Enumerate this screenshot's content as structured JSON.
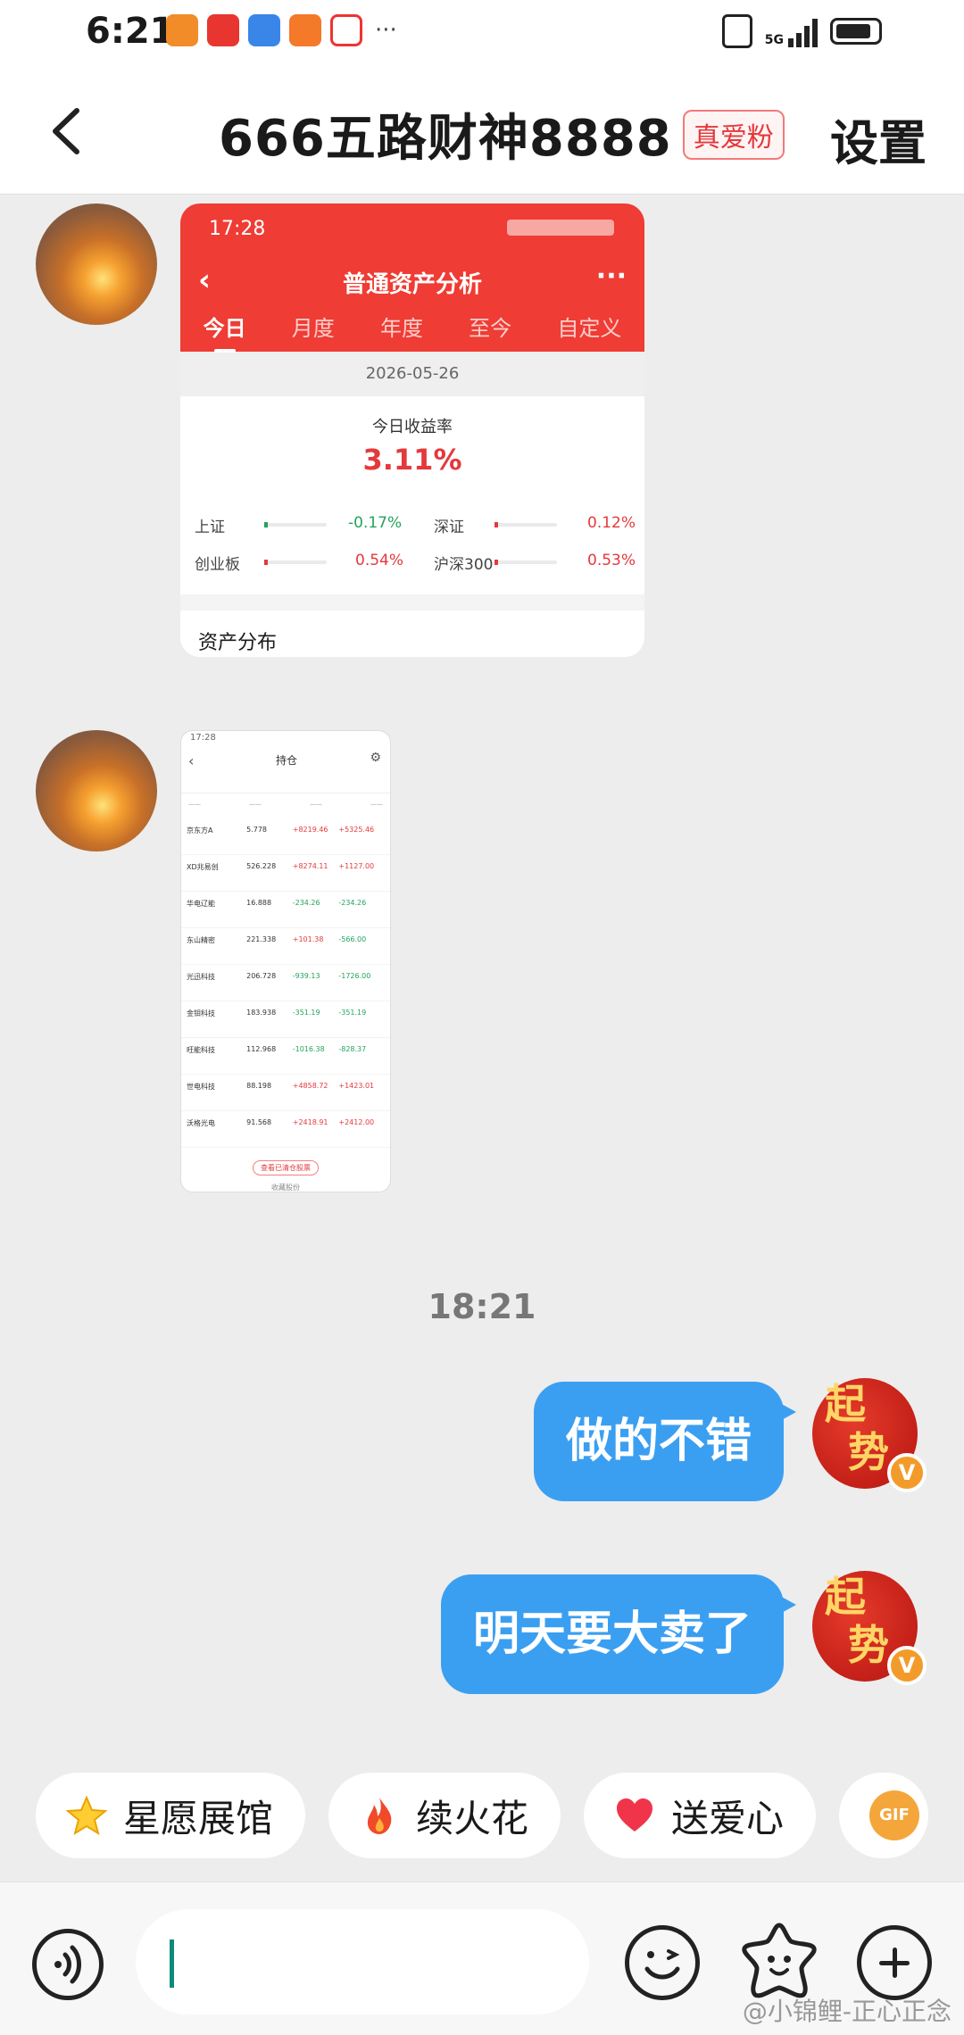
{
  "status_bar": {
    "time": "6:21",
    "more": "···",
    "network": "5G"
  },
  "header": {
    "title": "666五路财神8888",
    "badge": "真爱粉",
    "settings": "设置"
  },
  "messages": {
    "screenshot1": {
      "time": "17:28",
      "title": "普通资产分析",
      "tabs": [
        "今日",
        "月度",
        "年度",
        "至今",
        "自定义"
      ],
      "date": "2026-05-26",
      "rate_label": "今日收益率",
      "rate": "3.11%",
      "indices": [
        {
          "name": "上证",
          "value": "-0.17%"
        },
        {
          "name": "深证",
          "value": "0.12%"
        },
        {
          "name": "创业板",
          "value": "0.54%"
        },
        {
          "name": "沪深300",
          "value": "0.53%"
        }
      ],
      "section": "资产分布"
    },
    "screenshot2": {
      "time": "17:28",
      "title": "持仓",
      "rows": [
        {
          "name": "京东方A",
          "a": "5.778",
          "b": "+8219.46",
          "c": "+5325.46"
        },
        {
          "name": "XD兆易创",
          "a": "526.228",
          "b": "+8274.11",
          "c": "+1127.00"
        },
        {
          "name": "华电辽能",
          "a": "16.888",
          "b": "-234.26",
          "c": "-234.26"
        },
        {
          "name": "东山精密",
          "a": "221.338",
          "b": "+101.38",
          "c": "-566.00"
        },
        {
          "name": "光迅科技",
          "a": "206.728",
          "b": "-939.13",
          "c": "-1726.00"
        },
        {
          "name": "金钼科技",
          "a": "183.938",
          "b": "-351.19",
          "c": "-351.19"
        },
        {
          "name": "旺能科技",
          "a": "112.968",
          "b": "-1016.38",
          "c": "-828.37"
        },
        {
          "name": "世电科技",
          "a": "88.198",
          "b": "+4858.72",
          "c": "+1423.01"
        },
        {
          "name": "沃格光电",
          "a": "91.568",
          "b": "+2418.91",
          "c": "+2412.00"
        }
      ],
      "footer_btn": "查看已清仓股票",
      "note": "收藏股份"
    },
    "timestamp": "18:21",
    "bubble1": "做的不错",
    "bubble2": "明天要大卖了"
  },
  "avatar_text": {
    "line1": "起",
    "line2": "势",
    "verified": "V"
  },
  "quick_actions": [
    {
      "label": "星愿展馆",
      "icon": "star-icon"
    },
    {
      "label": "续火花",
      "icon": "fire-icon"
    },
    {
      "label": "送爱心",
      "icon": "heart-icon"
    },
    {
      "label": "GIF",
      "icon": "gif-icon"
    }
  ],
  "watermark": "@小锦鲤-正心正念"
}
